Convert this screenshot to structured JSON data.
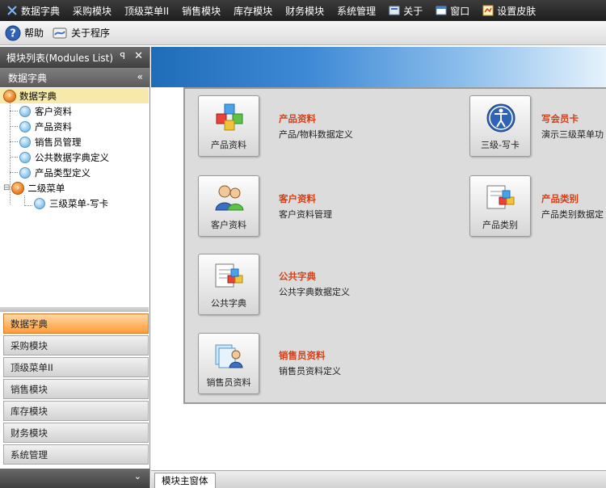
{
  "menubar": {
    "items": [
      {
        "label": "数据字典",
        "icon": "dictionary-icon"
      },
      {
        "label": "采购模块"
      },
      {
        "label": "顶级菜单II"
      },
      {
        "label": "销售模块"
      },
      {
        "label": "库存模块"
      },
      {
        "label": "财务模块"
      },
      {
        "label": "系统管理"
      },
      {
        "label": "关于",
        "icon": "about-icon"
      },
      {
        "label": "窗口",
        "icon": "window-icon"
      },
      {
        "label": "设置皮肤",
        "icon": "skin-icon"
      }
    ]
  },
  "toolbar": {
    "help_label": "帮助",
    "about_label": "关于程序"
  },
  "sidebar": {
    "title": "模块列表(Modules List)",
    "section_title": "数据字典",
    "tree": [
      {
        "label": "数据字典"
      },
      {
        "label": "客户资料"
      },
      {
        "label": "产品资料"
      },
      {
        "label": "销售员管理"
      },
      {
        "label": "公共数据字典定义"
      },
      {
        "label": "产品类型定义"
      },
      {
        "label": "二级菜单"
      },
      {
        "label": "三级菜单-写卡"
      }
    ],
    "nav": [
      {
        "label": "数据字典"
      },
      {
        "label": "采购模块"
      },
      {
        "label": "顶级菜单II"
      },
      {
        "label": "销售模块"
      },
      {
        "label": "库存模块"
      },
      {
        "label": "财务模块"
      },
      {
        "label": "系统管理"
      }
    ]
  },
  "modules": [
    {
      "card_label": "产品资料",
      "title": "产品资料",
      "desc": "产品/物料数据定义"
    },
    {
      "card_label": "客户资料",
      "title": "客户资料",
      "desc": "客户资料管理"
    },
    {
      "card_label": "公共字典",
      "title": "公共字典",
      "desc": "公共字典数据定义"
    },
    {
      "card_label": "销售员资料",
      "title": "销售员资料",
      "desc": "销售员资料定义"
    },
    {
      "card_label": "三级-写卡",
      "title": "写会员卡",
      "desc": "演示三级菜单功"
    },
    {
      "card_label": "产品类别",
      "title": "产品类别",
      "desc": "产品类别数据定"
    }
  ],
  "tabs": {
    "main_tab": "模块主窗体"
  },
  "colors": {
    "accent_orange": "#ff9b3a",
    "module_title": "#d2421a",
    "banner_blue": "#1f6cb8"
  }
}
